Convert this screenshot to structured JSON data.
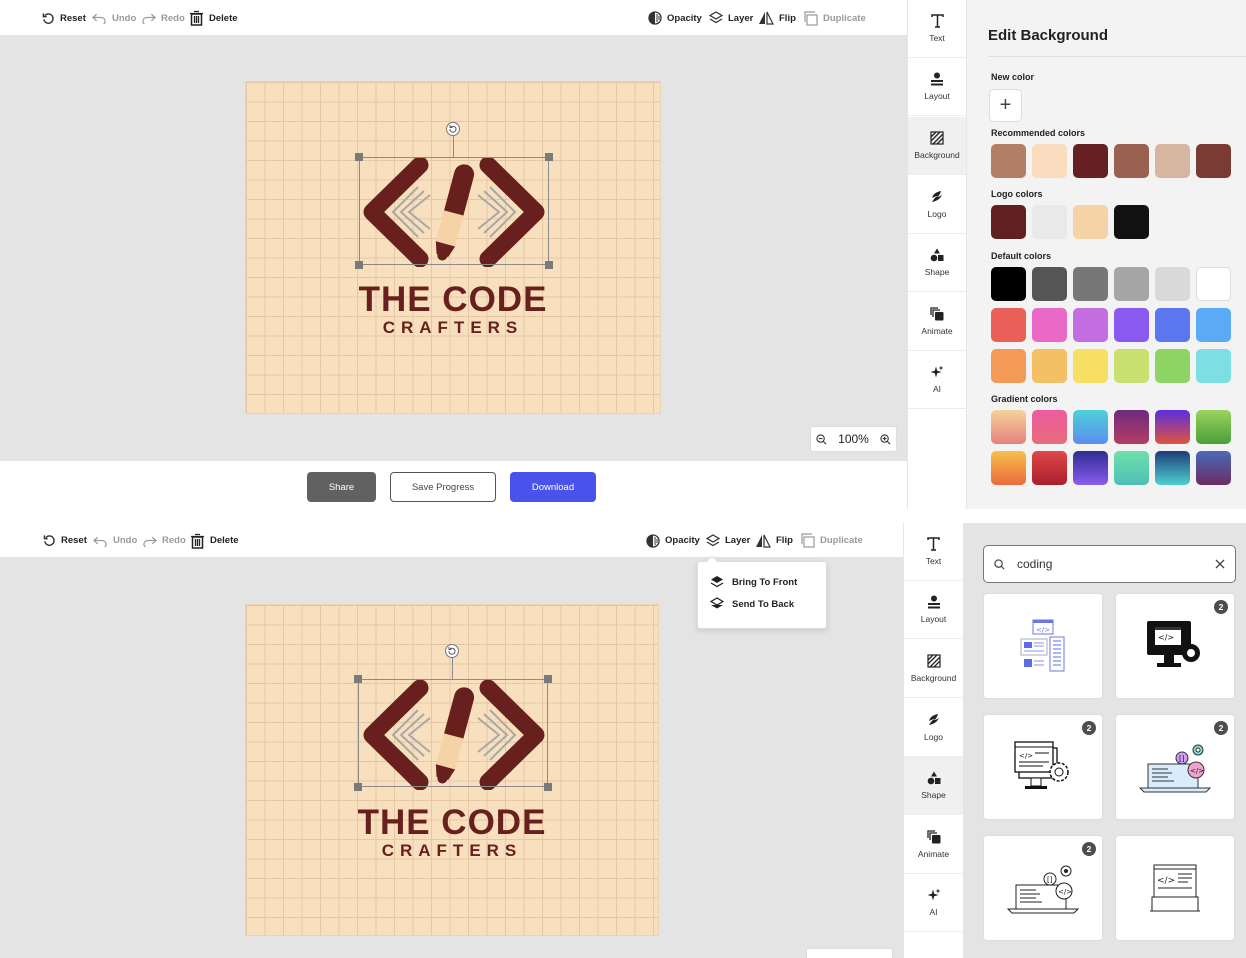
{
  "toolbar": {
    "reset": "Reset",
    "undo": "Undo",
    "redo": "Redo",
    "delete": "Delete",
    "opacity": "Opacity",
    "layer": "Layer",
    "flip": "Flip",
    "duplicate": "Duplicate"
  },
  "logo": {
    "line1": "THE CODE",
    "line2": "CRAFTERS"
  },
  "zoom": {
    "level": "100%"
  },
  "actions": {
    "share": "Share",
    "save": "Save Progress",
    "download": "Download"
  },
  "sidebar": {
    "items": [
      {
        "label": "Text",
        "icon": "text-icon"
      },
      {
        "label": "Layout",
        "icon": "layout-icon"
      },
      {
        "label": "Background",
        "icon": "background-icon"
      },
      {
        "label": "Logo",
        "icon": "logo-icon"
      },
      {
        "label": "Shape",
        "icon": "shape-icon"
      },
      {
        "label": "Animate",
        "icon": "animate-icon"
      },
      {
        "label": "AI",
        "icon": "ai-sparkle-icon"
      }
    ]
  },
  "edit_background": {
    "title": "Edit Background",
    "new_color_label": "New color",
    "new_color_button": "+",
    "recommended_label": "Recommended colors",
    "recommended": [
      "#b27e66",
      "#f8dcbd",
      "#661f23",
      "#9a6151",
      "#d7b6a1",
      "#7a3b34"
    ],
    "logo_colors_label": "Logo colors",
    "logo_colors": [
      "#61201f",
      "#e9e9e9",
      "#f5d3a6",
      "#111111"
    ],
    "default_label": "Default colors",
    "default": [
      [
        "#000000",
        "#555555",
        "#777777",
        "#a5a5a5",
        "#d9d9d9",
        "#ffffff"
      ],
      [
        "#ea5f57",
        "#ea69c6",
        "#c26ee0",
        "#8a59f0",
        "#5a77f0",
        "#5aaaf5"
      ],
      [
        "#f39a56",
        "#f3c063",
        "#f7df63",
        "#c9e26f",
        "#8ed465",
        "#7ddfe3"
      ]
    ],
    "gradient_label": "Gradient colors",
    "gradients": [
      [
        "#f6d29a",
        "#e58180"
      ],
      [
        "#ec5c9e",
        "#e86c7b"
      ],
      [
        "#4ed2d6",
        "#5b8cf0"
      ],
      [
        "#6d2b7e",
        "#b33d63"
      ],
      [
        "#5b2ee3",
        "#e0533c"
      ],
      [
        "#9ad45e",
        "#4a9e3a"
      ],
      [
        "#f8c04a",
        "#ea6b3b"
      ],
      [
        "#e04848",
        "#a91f2d"
      ],
      [
        "#2c2e91",
        "#8a5cf0"
      ],
      [
        "#6ee0a8",
        "#4fc0b8"
      ],
      [
        "#1e3a7a",
        "#4fd0d0"
      ],
      [
        "#4a6ab8",
        "#6b2d63"
      ]
    ]
  },
  "layer_menu": {
    "bring_front": "Bring To Front",
    "send_back": "Send To Back"
  },
  "search": {
    "value": "coding"
  },
  "results": [
    {
      "icon": "web-code-page-icon",
      "badge": ""
    },
    {
      "icon": "monitor-gear-code-icon",
      "badge": "2"
    },
    {
      "icon": "monitor-gear-outline-icon",
      "badge": "2"
    },
    {
      "icon": "laptop-code-bubbles-icon",
      "badge": "2"
    },
    {
      "icon": "laptop-code-outline-icon",
      "badge": "2"
    },
    {
      "icon": "laptop-code-simple-icon",
      "badge": ""
    }
  ]
}
